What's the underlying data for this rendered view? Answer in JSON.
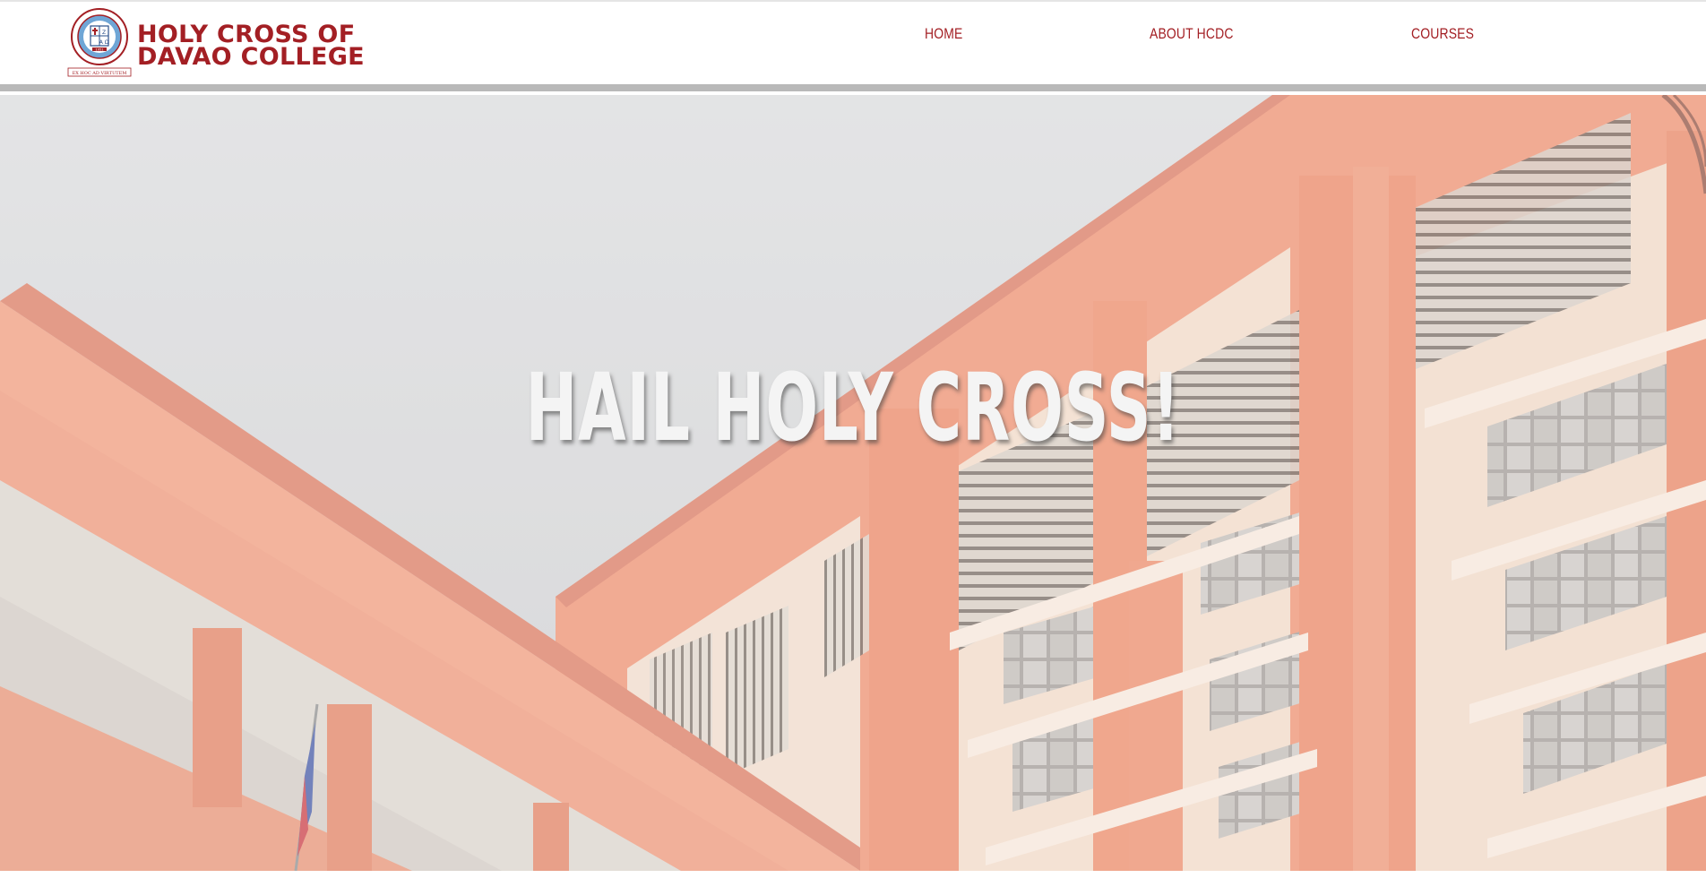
{
  "header": {
    "logo": {
      "name_line1": "HOLY CROSS OF",
      "name_line2": "DAVAO COLLEGE",
      "seal_motto": "EX HOC AD VIRTUTEM",
      "seal_ring_text": "HOLY CROSS OF DAVAO COLLEGE, INC.",
      "seal_year": "1951",
      "seal_letters": "A Ω"
    },
    "nav": [
      {
        "label": "HOME"
      },
      {
        "label": "ABOUT HCDC"
      },
      {
        "label": "COURSES"
      }
    ]
  },
  "hero": {
    "title": "HAIL HOLY CROSS!",
    "image": "campus-building-photo"
  },
  "colors": {
    "brand_red": "#a31f24",
    "building_orange": "#e98a66",
    "divider_gray": "#b9b9b9"
  }
}
